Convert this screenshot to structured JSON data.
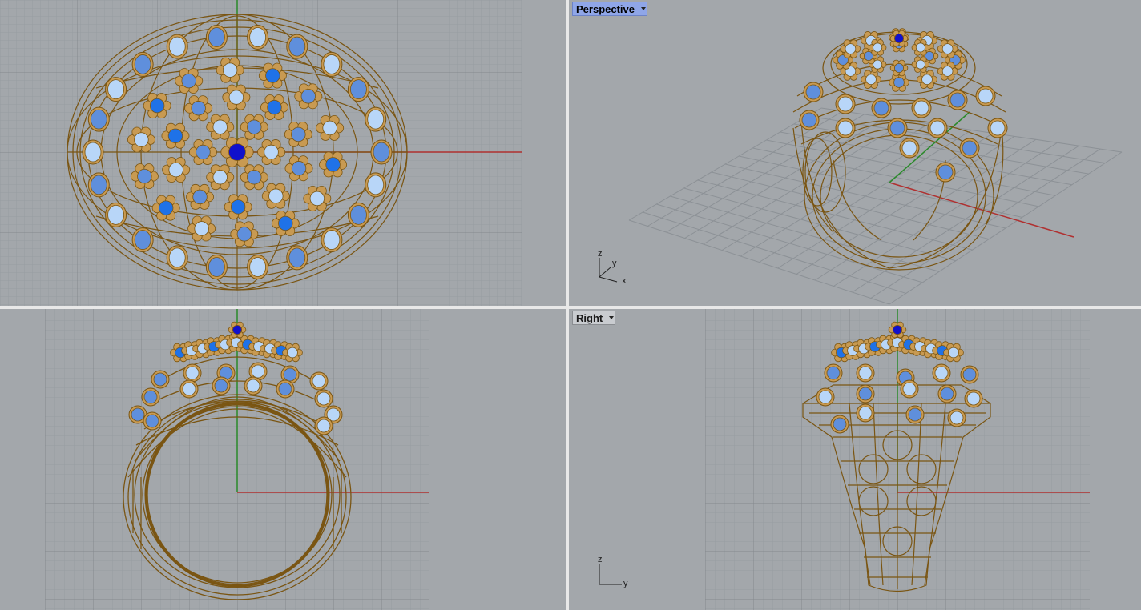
{
  "viewports": {
    "top": {
      "label": ""
    },
    "perspective": {
      "label": "Perspective",
      "axes": {
        "z": "z",
        "y": "y",
        "x": "x"
      }
    },
    "front": {
      "label": ""
    },
    "right": {
      "label": "Right",
      "axes": {
        "z": "z",
        "y": "y"
      }
    }
  },
  "colors": {
    "viewport_bg": "#a3a7ab",
    "grid_minor": "#959a9f",
    "grid_major": "#868b90",
    "wire": "#7a5512",
    "gold": "#c89a52",
    "stone_light": "#b8d6f8",
    "stone_mid": "#5f8fdc",
    "stone_bright": "#1f72e8",
    "stone_center": "#1111cc",
    "axis_x": "#b03030",
    "axis_y": "#2a8a2a",
    "active_label": "#8fa6e8"
  },
  "icons": [
    "dropdown-arrow-icon",
    "axis-indicator-icon"
  ]
}
